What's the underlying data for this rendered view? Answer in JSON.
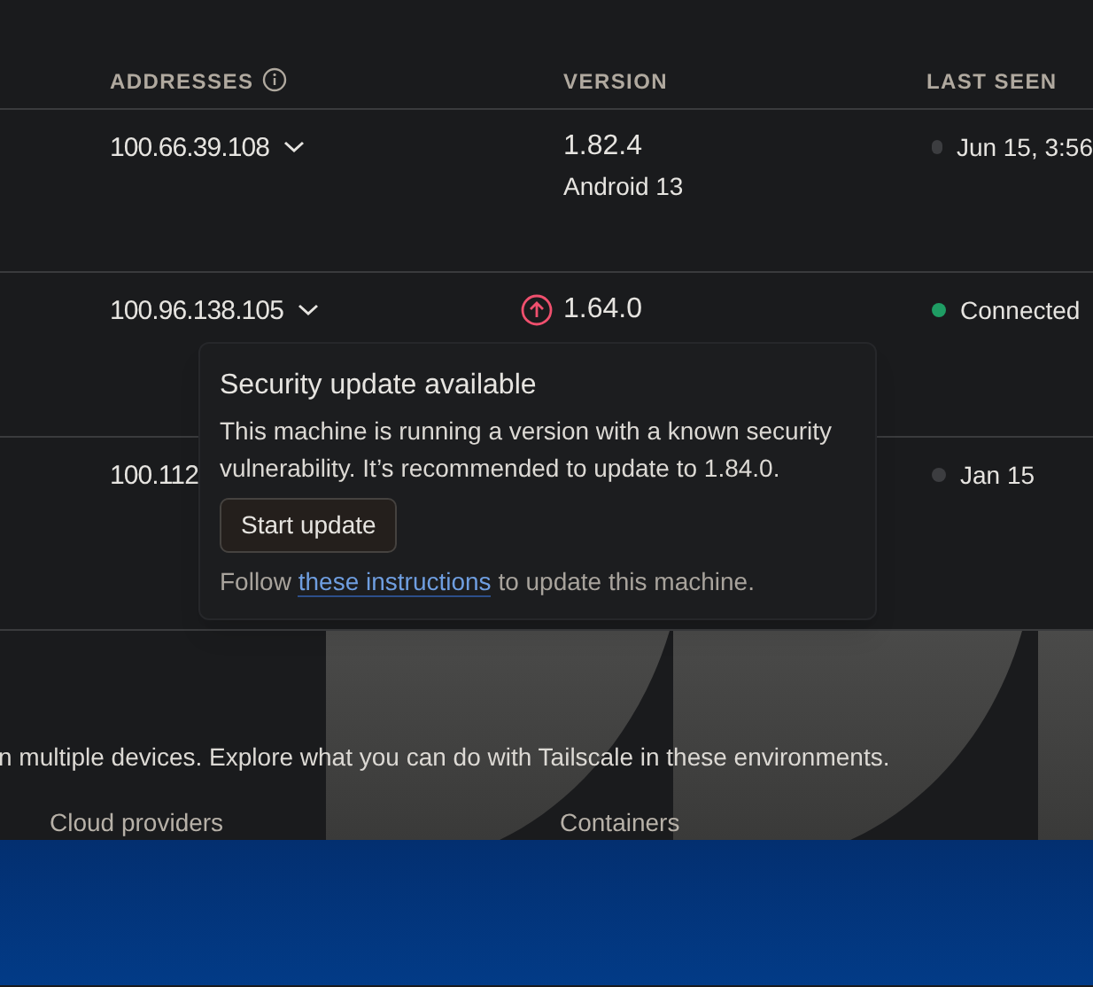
{
  "table": {
    "columns": [
      {
        "label": "ADDRESSES",
        "info": true
      },
      {
        "label": "VERSION"
      },
      {
        "label": "LAST SEEN"
      }
    ],
    "rows": [
      {
        "address": "100.66.39.108",
        "expandable": true,
        "version": "1.82.4",
        "os": "Android 13",
        "last_seen": "Jun 15, 3:56",
        "connected": false
      },
      {
        "address": "100.96.138.105",
        "expandable": true,
        "version": "1.64.0",
        "update_available": true,
        "last_seen": "Connected",
        "connected": true
      },
      {
        "address": "100.112",
        "last_seen": "Jan 15",
        "connected": false
      }
    ]
  },
  "popover": {
    "title": "Security update available",
    "body": "This machine is running a version with a known security vulnerability. It’s recommended to update to 1.84.0.",
    "button": "Start update",
    "footer_before": "Follow ",
    "footer_link": "these instructions",
    "footer_after": " to update this machine."
  },
  "environments": {
    "description": "n multiple devices. Explore what you can do with Tailscale in these environments.",
    "cards": [
      "Cloud providers",
      "Containers"
    ]
  }
}
